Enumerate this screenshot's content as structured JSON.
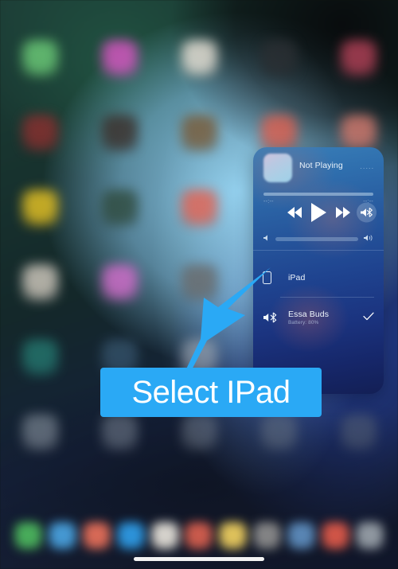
{
  "annotation": {
    "label": "Select IPad",
    "accent_color": "#2aa9f5",
    "arrow": "arrow-up-right"
  },
  "media_panel": {
    "now_playing": {
      "title": "Not Playing",
      "menu_dots": "·····",
      "artwork": "album-art-placeholder"
    },
    "progress": {
      "elapsed": "--:--",
      "remaining": "--:--",
      "percent": 0
    },
    "transport": {
      "rewind": "rewind-icon",
      "play": "play-icon",
      "forward": "fast-forward-icon",
      "airplay": "airplay-audio-icon"
    },
    "volume": {
      "low_icon": "speaker-low-icon",
      "high_icon": "speaker-high-icon",
      "level": 92
    },
    "devices": [
      {
        "name": "iPad",
        "icon": "ipad-icon",
        "subtitle": "",
        "selected": false
      },
      {
        "name": "Essa Buds",
        "icon": "bluetooth-speaker-icon",
        "subtitle": "Battery: 80%",
        "selected": true
      }
    ],
    "check_glyph": "✓"
  },
  "home_screen": {
    "app_icons": [
      "#6fd07a",
      "#e056c8",
      "#f0e8dc",
      "#2b2f33",
      "#b8435a",
      "#8d2f2f",
      "#3c2f2a",
      "#7a5a36",
      "#e2604f",
      "#d87b6e",
      "#efc924",
      "#2f4a3c",
      "#e8604e",
      "#ddd3c6",
      "#d6cec2",
      "#d8d0c4",
      "#d96fd0",
      "#6a6a6a",
      "#6d8ab0",
      "#9a5a5a",
      "#2fae9a",
      "#4a6f8e",
      "#c4c8cc",
      "#a8a2a8",
      "#5c5258",
      "#a8b2bc",
      "#8892a0",
      "#7a8492",
      "#6e7884",
      "#606a76"
    ],
    "dock_icons": [
      "#4db85e",
      "#4aa3e0",
      "#e8705a",
      "#2f9de8",
      "#e6e2da",
      "#d9604f",
      "#f0d060",
      "#8d8d8d",
      "#5f8fc0",
      "#e05a4a",
      "#9aa2aa"
    ],
    "home_indicator": "home-indicator-bar"
  }
}
